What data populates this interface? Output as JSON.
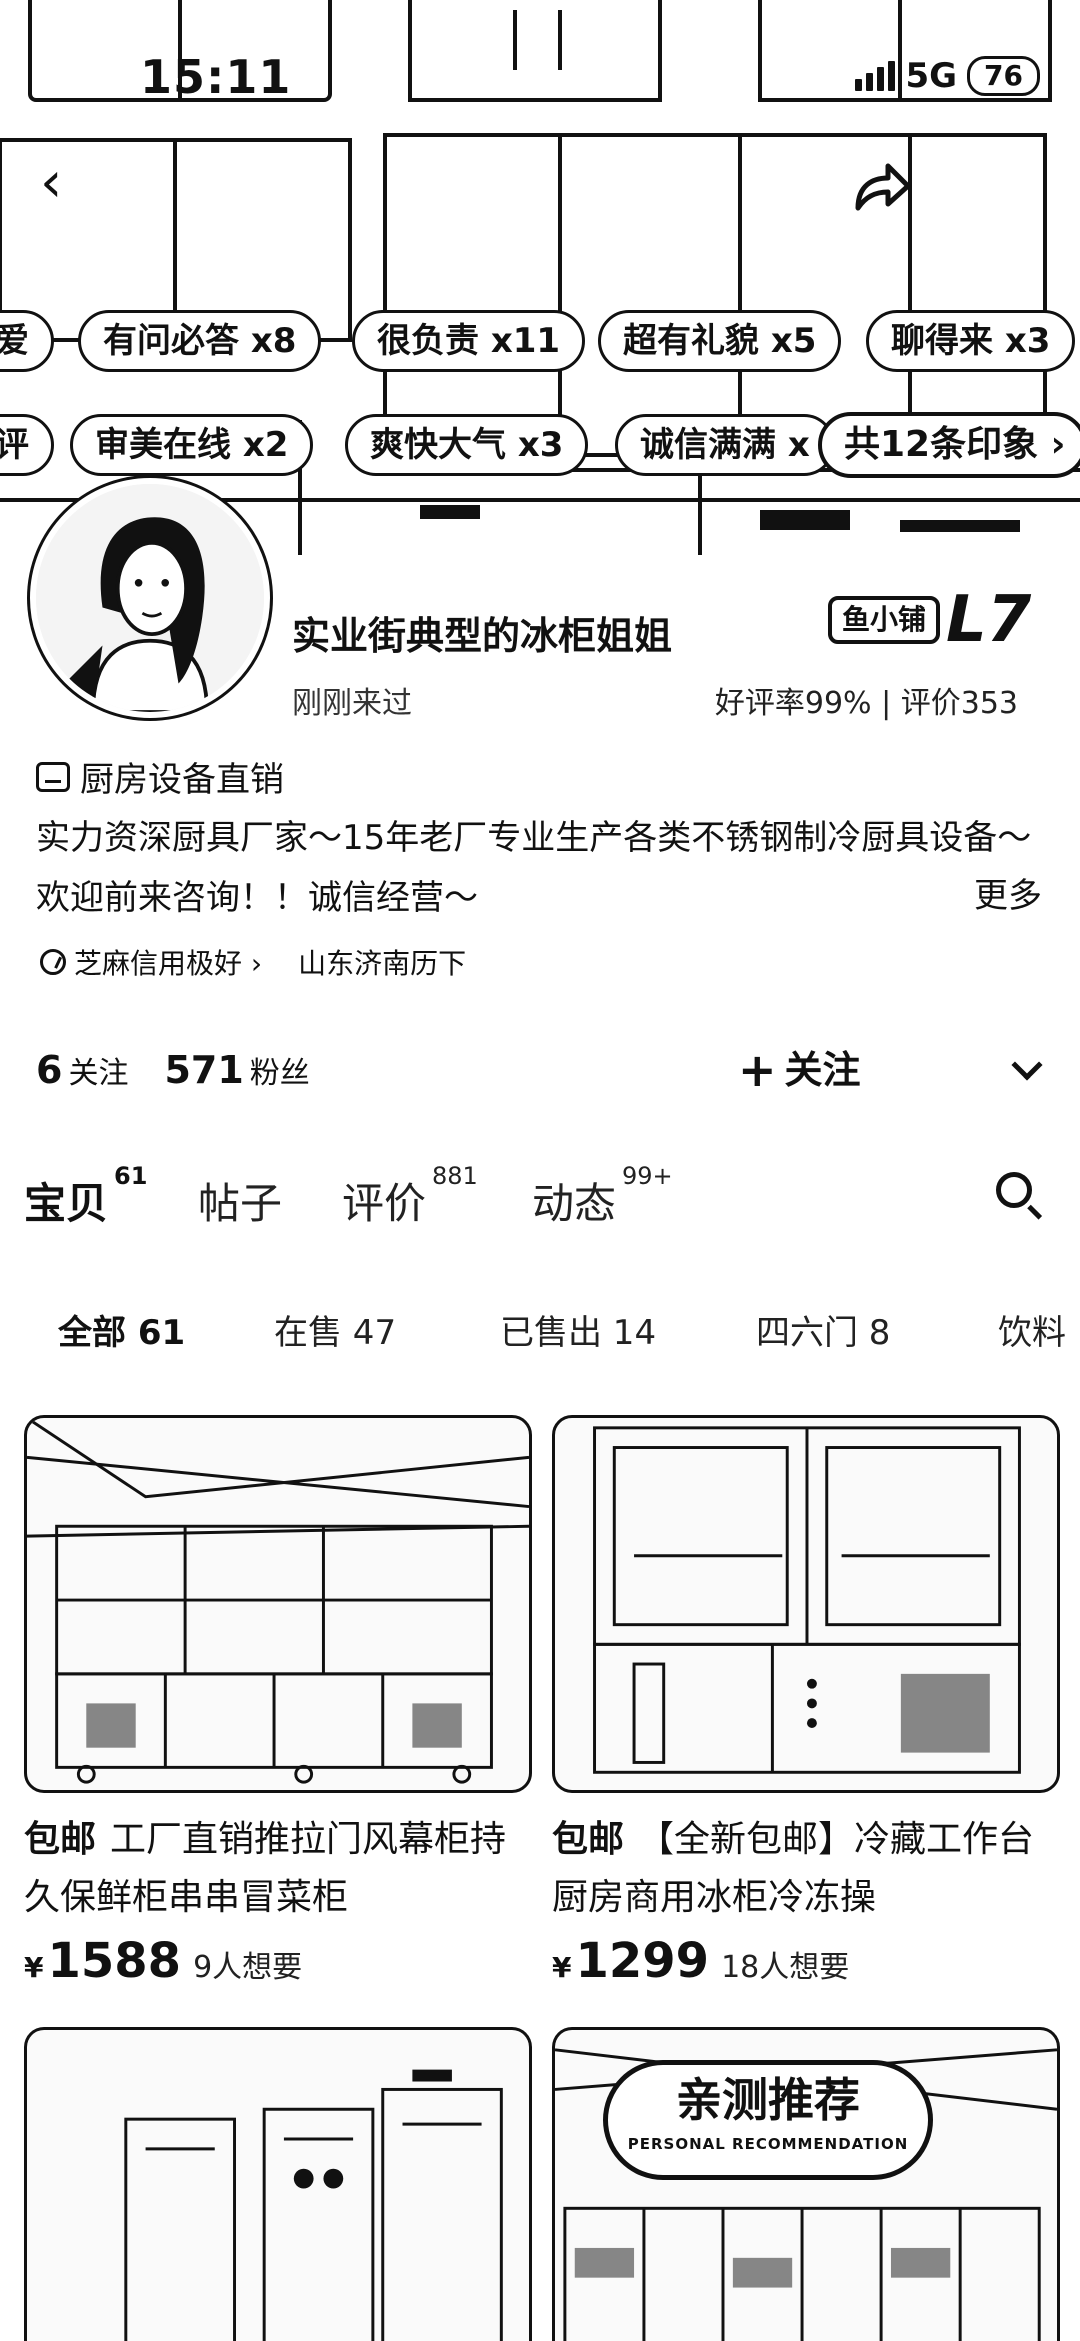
{
  "status_bar": {
    "time": "15:11",
    "network": "5G",
    "battery": "76"
  },
  "hero": {
    "impressions_row1": [
      "爱",
      "有问必答 x8",
      "很负责 x11",
      "超有礼貌 x5",
      "聊得来 x3"
    ],
    "impressions_row2": [
      "评",
      "审美在线 x2",
      "爽快大气 x3",
      "诚信满满 x"
    ],
    "impressions_more": "共12条印象 ›"
  },
  "profile": {
    "name": "实业街典型的冰柜姐姐",
    "badge": "鱼小铺",
    "level": "L7",
    "last_seen": "刚刚来过",
    "rating": "好评率99% | 评价353",
    "category": "厨房设备直销",
    "bio": "实力资深厨具厂家～15年老厂专业生产各类不锈钢制冷厨具设备～欢迎前来咨询！！诚信经营～",
    "more": "更多",
    "credit": "芝麻信用极好 ›",
    "location": "山东济南历下"
  },
  "stats": {
    "following_num": "6",
    "following_label": "关注",
    "fans_num": "571",
    "fans_label": "粉丝",
    "follow_button": "关注"
  },
  "tabs": [
    {
      "label": "宝贝",
      "count": "61"
    },
    {
      "label": "帖子",
      "count": ""
    },
    {
      "label": "评价",
      "count": "881"
    },
    {
      "label": "动态",
      "count": "99+"
    }
  ],
  "filters": [
    "全部 61",
    "在售 47",
    "已售出 14",
    "四六门 8",
    "饮料"
  ],
  "products": [
    {
      "tag": "包邮",
      "title": "工厂直销推拉门风幕柜持久保鲜柜串串冒菜柜",
      "price_symbol": "¥",
      "price": "1588",
      "wants": "9人想要"
    },
    {
      "tag": "包邮",
      "title": "【全新包邮】冷藏工作台厨房商用冰柜冷冻操",
      "price_symbol": "¥",
      "price": "1299",
      "wants": "18人想要"
    }
  ],
  "recommend": {
    "title": "亲测推荐",
    "subtitle": "PERSONAL RECOMMENDATION"
  }
}
